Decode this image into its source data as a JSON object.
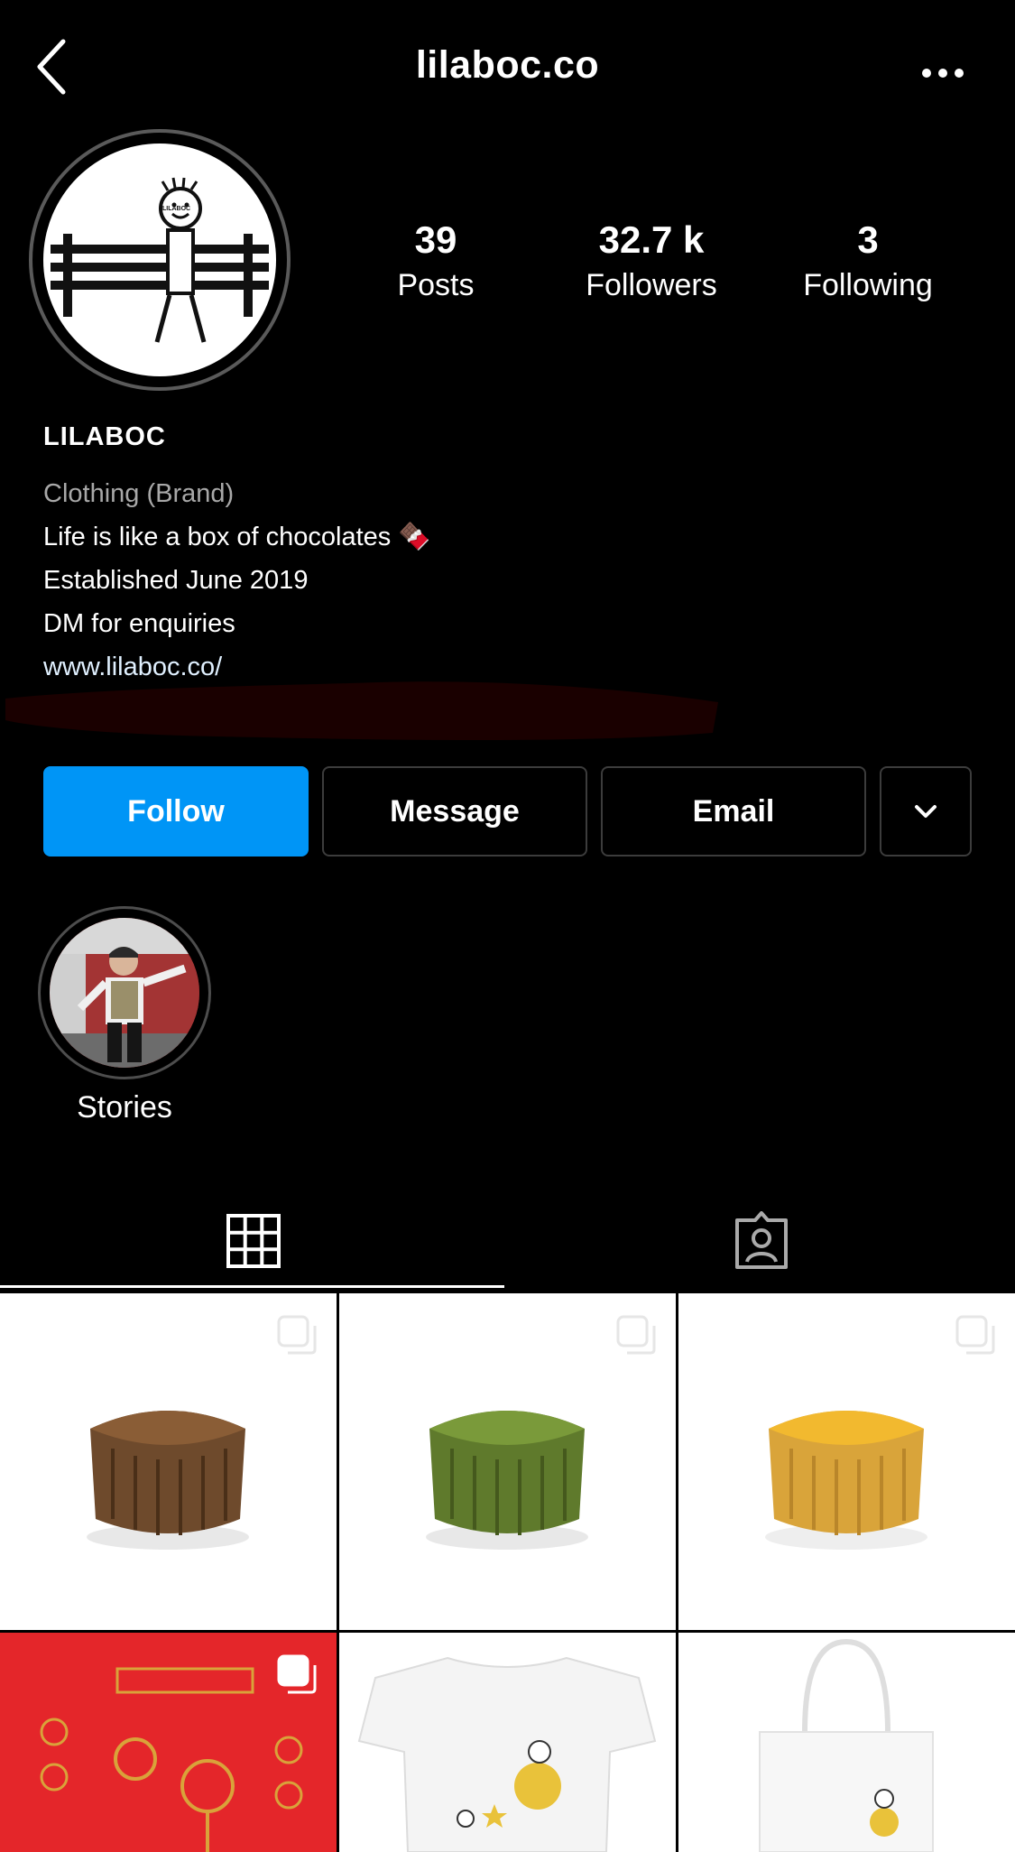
{
  "header": {
    "username": "lilaboc.co",
    "back_icon": "chevron-left-icon",
    "more_icon": "more-horizontal-icon"
  },
  "profile": {
    "avatar_text": "LILABOC",
    "stats": [
      {
        "value": "39",
        "label": "Posts"
      },
      {
        "value": "32.7 k",
        "label": "Followers"
      },
      {
        "value": "3",
        "label": "Following"
      }
    ]
  },
  "bio": {
    "name": "LILABOC",
    "category": "Clothing (Brand)",
    "lines": [
      "Life is like a box of chocolates 🍫",
      "Established June 2019",
      "DM for enquiries"
    ],
    "link": "www.lilaboc.co/"
  },
  "actions": {
    "follow": "Follow",
    "message": "Message",
    "email": "Email",
    "more_icon": "chevron-down-icon"
  },
  "highlights": [
    {
      "label": "Stories"
    }
  ],
  "tabs": {
    "grid_icon": "grid-icon",
    "tagged_icon": "tagged-person-icon"
  },
  "posts": [
    {
      "content": "mooncake-chocolate",
      "multi": true
    },
    {
      "content": "mooncake-matcha",
      "multi": true
    },
    {
      "content": "mooncake-golden",
      "multi": true
    },
    {
      "content": "red-packet",
      "multi": true
    },
    {
      "content": "tshirt",
      "multi": false
    },
    {
      "content": "tote-bag",
      "multi": false
    }
  ],
  "colors": {
    "background": "#000000",
    "accent": "#0095f6",
    "secondary_text": "#a8a8a8"
  }
}
